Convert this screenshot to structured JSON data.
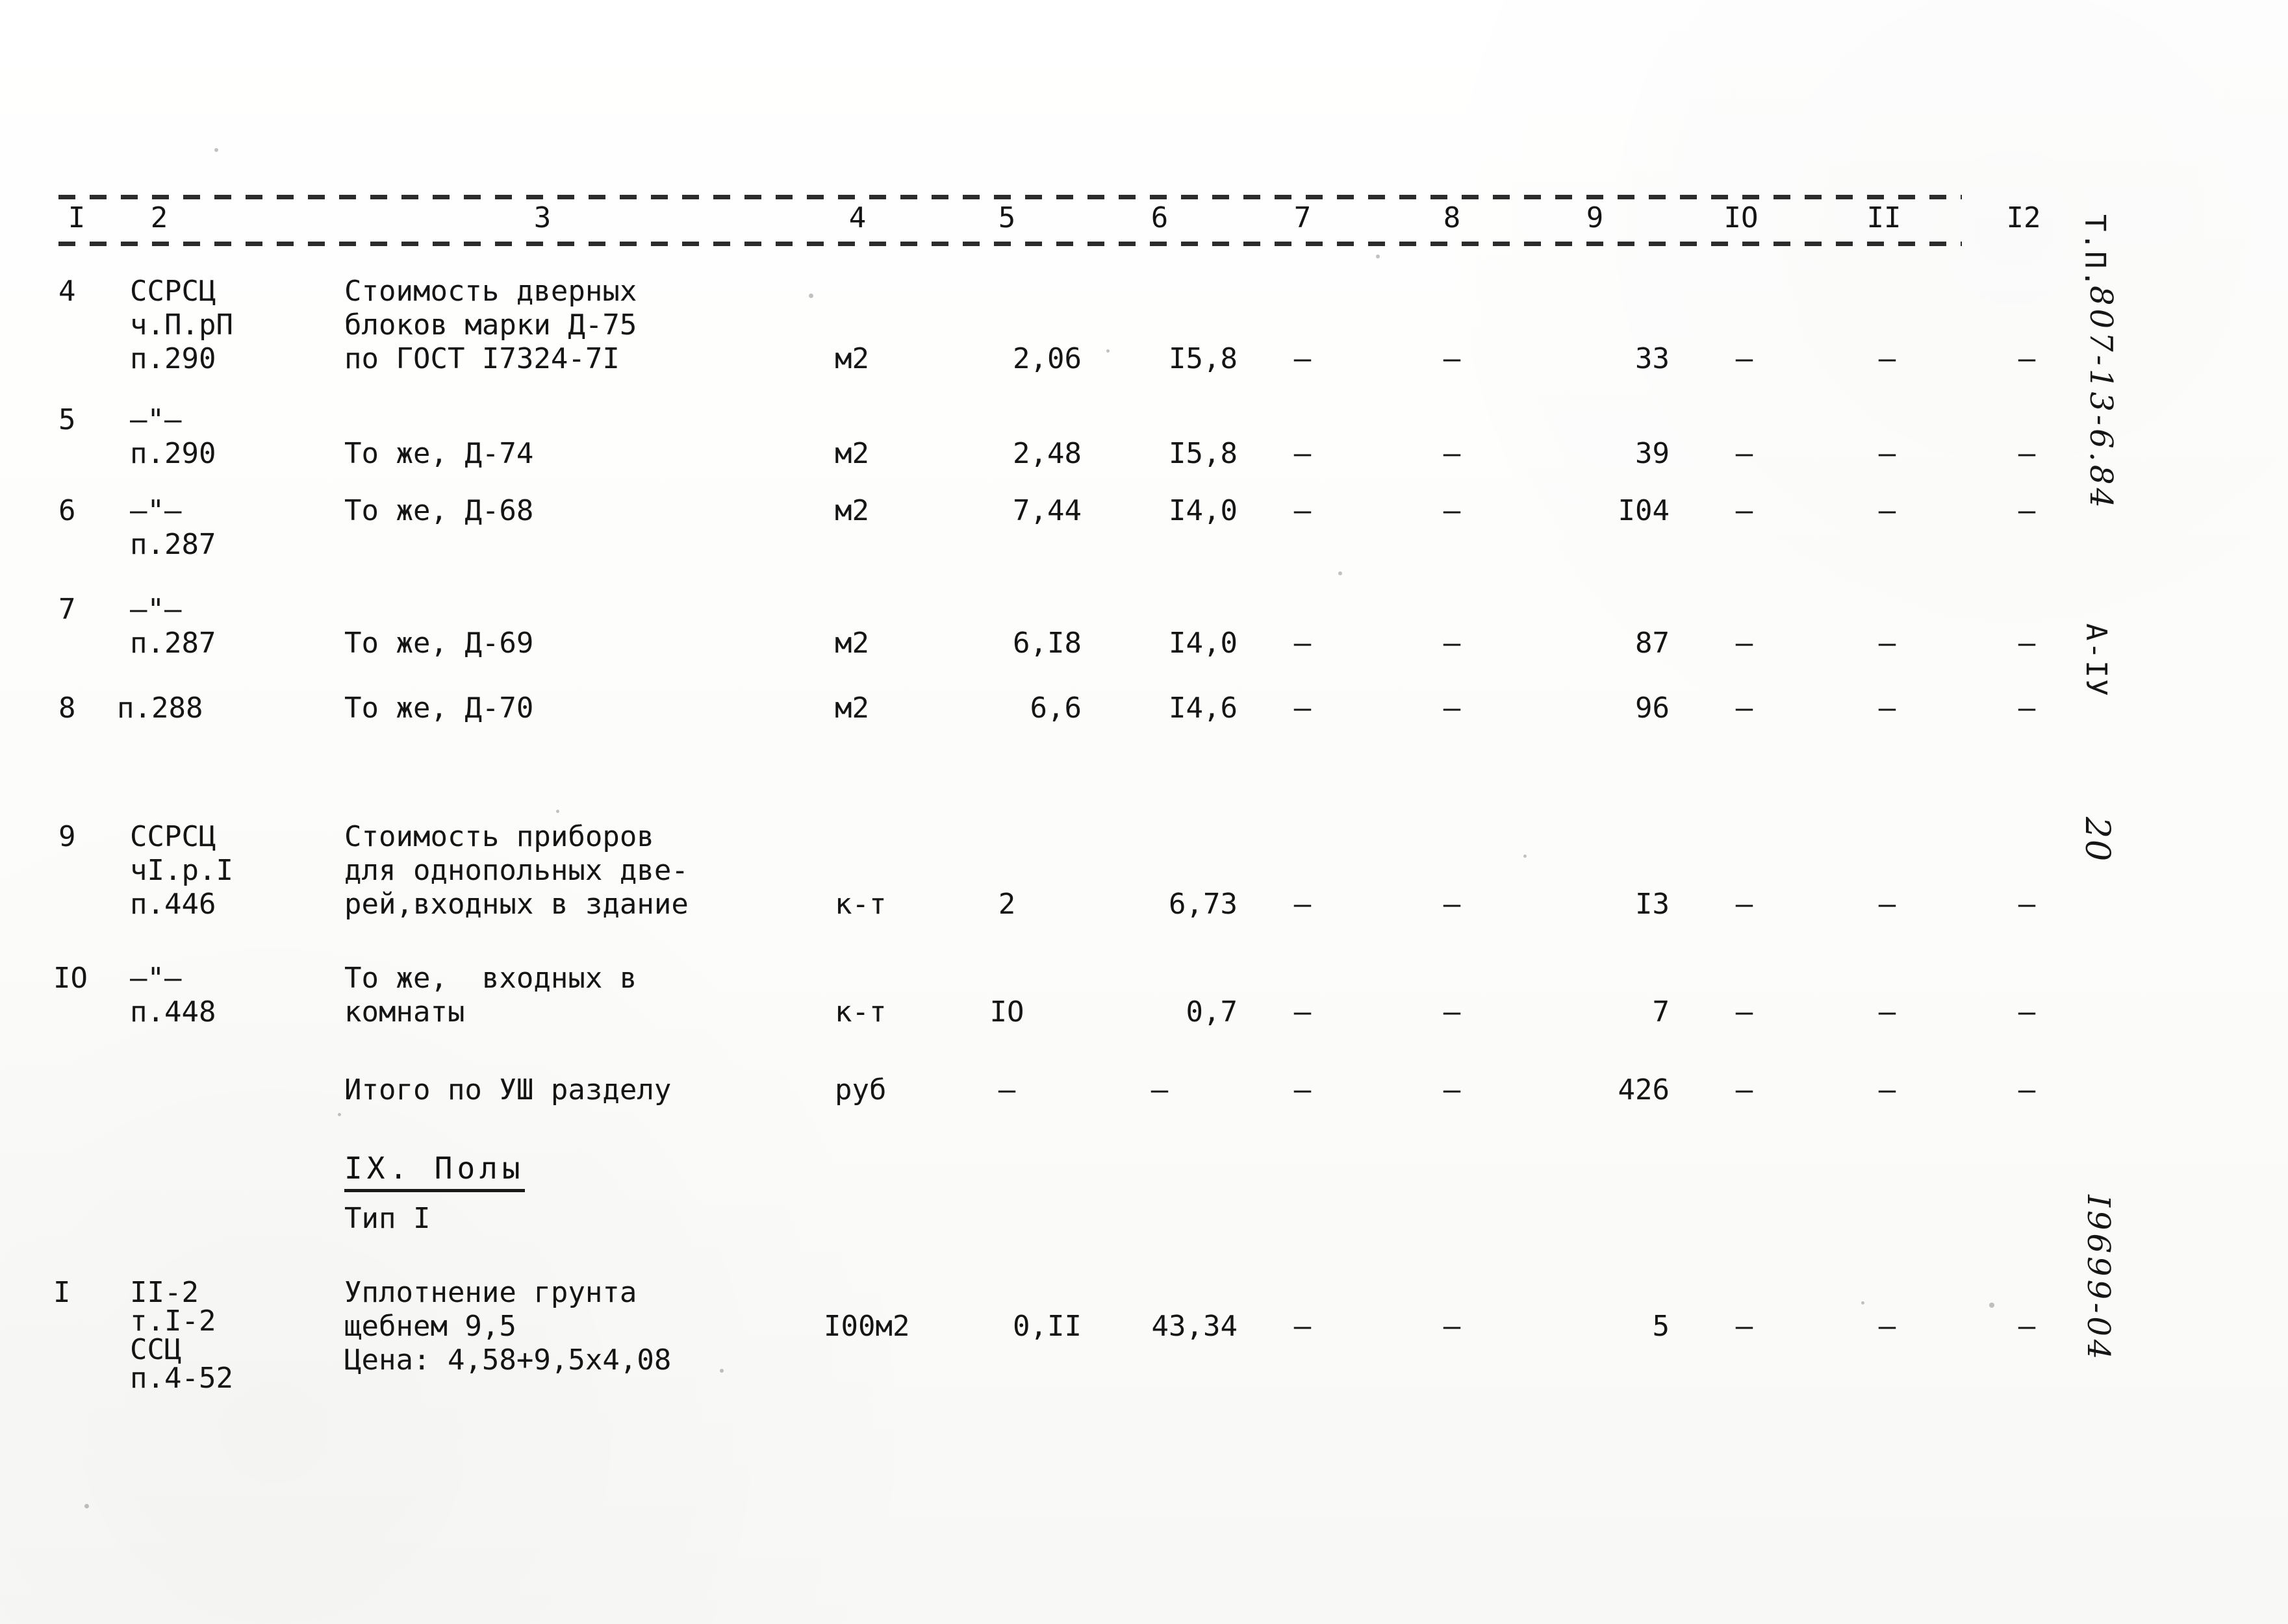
{
  "document": {
    "type": "construction-cost-estimate-table",
    "language": "ru"
  },
  "table": {
    "column_numbers": [
      "I",
      "2",
      "3",
      "4",
      "5",
      "6",
      "7",
      "8",
      "9",
      "IO",
      "II",
      "I2"
    ],
    "dash": "–",
    "rows": [
      {
        "no": "4",
        "code": [
          "ССРСЦ",
          "ч.П.рП",
          "п.290"
        ],
        "desc": [
          "Стоимость дверных",
          "блоков марки Д-75",
          "по ГОСТ I7324-7I"
        ],
        "unit": "м2",
        "qty": "2,06",
        "price": "I5,8",
        "c7": "–",
        "c8": "–",
        "c9": "33",
        "c10": "–",
        "c11": "–",
        "c12": "–"
      },
      {
        "no": "5",
        "code": [
          "–\"–",
          "п.290"
        ],
        "desc": [
          "То же, Д-74"
        ],
        "unit": "м2",
        "qty": "2,48",
        "price": "I5,8",
        "c7": "–",
        "c8": "–",
        "c9": "39",
        "c10": "–",
        "c11": "–",
        "c12": "–"
      },
      {
        "no": "6",
        "code": [
          "–\"–",
          "п.287"
        ],
        "desc": [
          "То же, Д-68"
        ],
        "unit": "м2",
        "qty": "7,44",
        "price": "I4,0",
        "c7": "–",
        "c8": "–",
        "c9": "I04",
        "c10": "–",
        "c11": "–",
        "c12": "–"
      },
      {
        "no": "7",
        "code": [
          "–\"–",
          "п.287"
        ],
        "desc": [
          "То же, Д-69"
        ],
        "unit": "м2",
        "qty": "6,I8",
        "price": "I4,0",
        "c7": "–",
        "c8": "–",
        "c9": "87",
        "c10": "–",
        "c11": "–",
        "c12": "–"
      },
      {
        "no": "8",
        "code": [
          "п.288"
        ],
        "desc": [
          "То же, Д-70"
        ],
        "unit": "м2",
        "qty": "6,6",
        "price": "I4,6",
        "c7": "–",
        "c8": "–",
        "c9": "96",
        "c10": "–",
        "c11": "–",
        "c12": "–"
      },
      {
        "no": "9",
        "code": [
          "ССРСЦ",
          "чI.р.I",
          "п.446"
        ],
        "desc": [
          "Стоимость приборов",
          "для однопольных две-",
          "рей,входных в здание"
        ],
        "unit": "к-т",
        "qty": "2",
        "price": "6,73",
        "c7": "–",
        "c8": "–",
        "c9": "I3",
        "c10": "–",
        "c11": "–",
        "c12": "–"
      },
      {
        "no": "IO",
        "code": [
          "–\"–",
          "п.448"
        ],
        "desc": [
          "То же,  входных в",
          "комнаты"
        ],
        "unit": "к-т",
        "qty": "IO",
        "price": "0,7",
        "c7": "–",
        "c8": "–",
        "c9": "7",
        "c10": "–",
        "c11": "–",
        "c12": "–"
      },
      {
        "no": "",
        "code": [],
        "desc": [
          "Итого по УШ разделу"
        ],
        "unit": "руб",
        "qty": "–",
        "price": "–",
        "c7": "–",
        "c8": "–",
        "c9": "426",
        "c10": "–",
        "c11": "–",
        "c12": "–"
      },
      {
        "no": "I",
        "code": [
          "II-2",
          "т.I-2",
          "ССЦ",
          "п.4-52"
        ],
        "desc": [
          "Уплотнение грунта",
          "щебнем 9,5",
          "Цена: 4,58+9,5х4,08"
        ],
        "unit": "I00м2",
        "qty": "0,II",
        "price": "43,34",
        "c7": "–",
        "c8": "–",
        "c9": "5",
        "c10": "–",
        "c11": "–",
        "c12": "–"
      }
    ]
  },
  "section": {
    "heading": "IX. Полы",
    "subheading": "Тип I"
  },
  "margin": {
    "typed_prefix": "Т.П.",
    "handwritten_code": "807-13-6.84",
    "album": "А-IУ",
    "page_number": "20",
    "archive_number": "I9699-04"
  }
}
